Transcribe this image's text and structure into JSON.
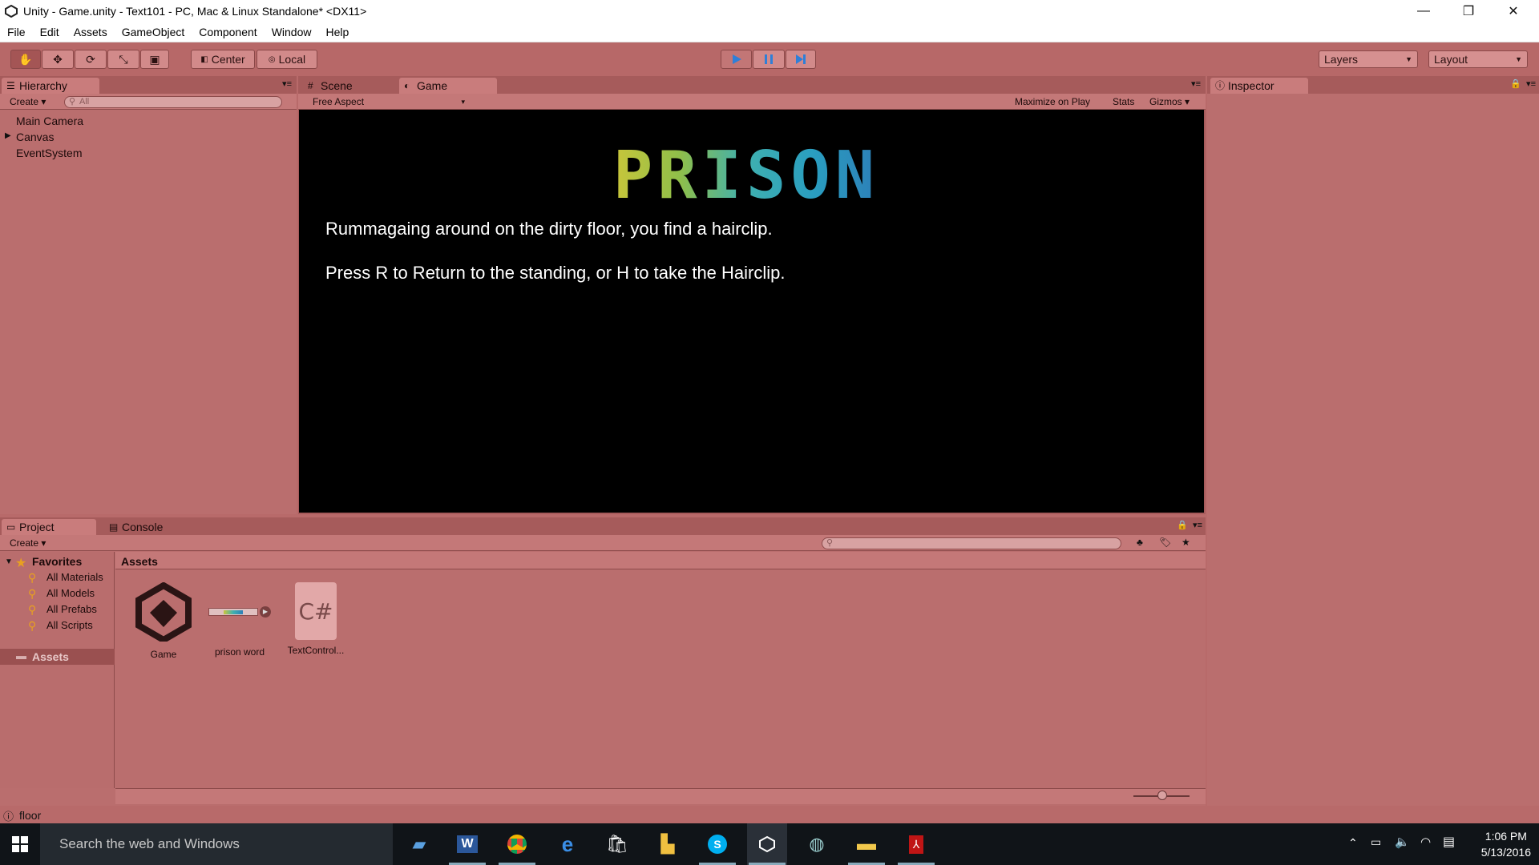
{
  "window": {
    "title": "Unity - Game.unity - Text101 - PC, Mac & Linux Standalone* <DX11>",
    "minimize": "—",
    "restore": "❐",
    "close": "✕"
  },
  "menu": [
    "File",
    "Edit",
    "Assets",
    "GameObject",
    "Component",
    "Window",
    "Help"
  ],
  "toolbar": {
    "pivot_center": "Center",
    "pivot_local": "Local",
    "layers": "Layers",
    "layout": "Layout"
  },
  "hierarchy": {
    "tab": "Hierarchy",
    "create": "Create",
    "search_placeholder": "All",
    "items": [
      "Main Camera",
      "Canvas",
      "EventSystem"
    ]
  },
  "scene_tab": "Scene",
  "game": {
    "tab": "Game",
    "aspect": "Free Aspect",
    "maximize": "Maximize on Play",
    "stats": "Stats",
    "gizmos": "Gizmos",
    "logo_text": "PRISON",
    "line1": "Rummagaing around on the dirty floor, you find a hairclip.",
    "line2": "Press R to Return to the standing, or H to take the Hairclip."
  },
  "inspector": {
    "tab": "Inspector"
  },
  "project": {
    "tab": "Project",
    "console_tab": "Console",
    "create": "Create",
    "favorites": "Favorites",
    "fav_items": [
      "All Materials",
      "All Models",
      "All Prefabs",
      "All Scripts"
    ],
    "assets_folder": "Assets",
    "assets_header": "Assets",
    "assets": [
      {
        "name": "Game",
        "icon": "unity-scene-icon"
      },
      {
        "name": "prison word",
        "icon": "sprite-icon"
      },
      {
        "name": "TextControl...",
        "icon": "csharp-script-icon"
      }
    ]
  },
  "status": {
    "message": "floor"
  },
  "taskbar": {
    "search": "Search the web and Windows",
    "time": "1:06 PM",
    "date": "5/13/2016"
  },
  "colors": {
    "tint": "#b86a6a",
    "play_active": "#2f7fd8"
  }
}
